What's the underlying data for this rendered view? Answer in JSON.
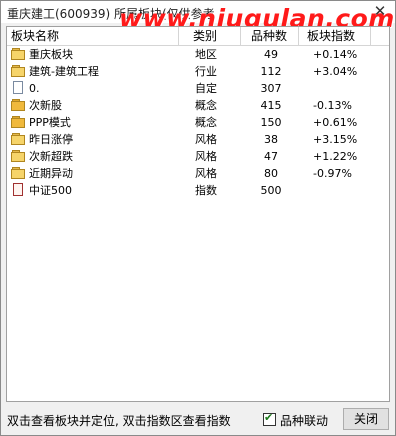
{
  "window": {
    "title": "重庆建工(600939)  所属板块(仅供参考",
    "watermark": "www.niugulan.com",
    "close_glyph": "✕"
  },
  "table": {
    "columns": [
      "板块名称",
      "类别",
      "品种数",
      "板块指数"
    ],
    "rows": [
      {
        "icon": "folder-icon",
        "name": "重庆板块",
        "type": "地区",
        "count": "49",
        "index": "+0.14%"
      },
      {
        "icon": "folder-icon",
        "name": "建筑-建筑工程",
        "type": "行业",
        "count": "112",
        "index": "+3.04%"
      },
      {
        "icon": "document-icon",
        "name": "0.",
        "type": "自定",
        "count": "307",
        "index": ""
      },
      {
        "icon": "folder-icon",
        "name": "次新股",
        "type": "概念",
        "count": "415",
        "index": "-0.13%"
      },
      {
        "icon": "folder-icon",
        "name": "PPP模式",
        "type": "概念",
        "count": "150",
        "index": "+0.61%"
      },
      {
        "icon": "folder-icon",
        "name": "昨日涨停",
        "type": "风格",
        "count": "38",
        "index": "+3.15%"
      },
      {
        "icon": "folder-icon",
        "name": "次新超跌",
        "type": "风格",
        "count": "47",
        "index": "+1.22%"
      },
      {
        "icon": "folder-icon",
        "name": "近期异动",
        "type": "风格",
        "count": "80",
        "index": "-0.97%"
      },
      {
        "icon": "index-document-icon",
        "name": "中证500",
        "type": "指数",
        "count": "500",
        "index": ""
      }
    ]
  },
  "status": {
    "hint": "双击查看板块并定位, 双击指数区查看指数",
    "checkbox_label": "品种联动",
    "checkbox_checked": true,
    "close_label": "关闭"
  }
}
